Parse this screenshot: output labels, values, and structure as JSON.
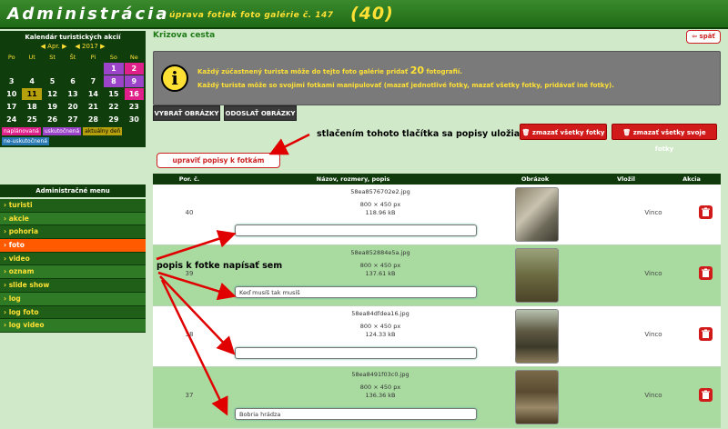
{
  "header": {
    "title": "Administrácia",
    "subtitle": "úprava fotiek foto galérie č. 147",
    "count": "(40)"
  },
  "calendar": {
    "title": "Kalendár turistických akcií",
    "month": "Apr.",
    "year": "2017",
    "prev": "◀",
    "next": "▶",
    "weekdays": [
      "Po",
      "Ut",
      "St",
      "Št",
      "Pi",
      "So",
      "Ne"
    ],
    "legend": [
      "naplánovaná",
      "uskutočnená",
      "aktuálny deň",
      "ne-uskutočnená"
    ]
  },
  "menu": {
    "title": "Administračné menu",
    "items": [
      "turisti",
      "akcie",
      "pohoria",
      "foto",
      "video",
      "oznam",
      "slide show",
      "log",
      "log foto",
      "log video"
    ],
    "active": "foto"
  },
  "main": {
    "title": "Krizova cesta",
    "back": "späť",
    "info1_pre": "Každý zúčastnený turista môže do tejto foto galérie pridať",
    "info1_num": "20",
    "info1_post": "fotografií.",
    "info2": "Každý turista môže so svojimi fotkami manipulovať (mazať jednotlivé fotky, mazať všetky fotky, pridávať iné fotky).",
    "btn_select": "VYBRAŤ OBRÁZKY",
    "btn_send": "ODOSLAŤ OBRÁZKY",
    "btn_delete_all": "zmazať všetky fotky",
    "btn_delete_own": "zmazať všetky svoje fotky",
    "btn_edit": "upraviť popisy k fotkám",
    "annotation_top": "stlačením tohoto tlačítka sa popisy uložia",
    "annotation_left": "popis k fotke napísať sem"
  },
  "table": {
    "headers": [
      "Por. č.",
      "Názov, rozmery, popis",
      "Obrázok",
      "Vložil",
      "Akcia"
    ],
    "rows": [
      {
        "por": "40",
        "file": "58ea8576702e2.jpg",
        "dims": "800 × 450 px",
        "size": "118.96 kB",
        "desc": "",
        "user": "Vinco"
      },
      {
        "por": "39",
        "file": "58ea852884e5a.jpg",
        "dims": "800 × 450 px",
        "size": "137.61 kB",
        "desc": "Keď musíš tak musíš",
        "user": "Vinco"
      },
      {
        "por": "38",
        "file": "58ea84dfdea16.jpg",
        "dims": "800 × 450 px",
        "size": "124.33 kB",
        "desc": "",
        "user": "Vinco"
      },
      {
        "por": "37",
        "file": "58ea8491f03c0.jpg",
        "dims": "800 × 450 px",
        "size": "136.36 kB",
        "desc": "Bobria hrádza",
        "user": "Vinco"
      }
    ]
  },
  "colors": {
    "brand_green": "#1f6a16",
    "accent_yellow": "#ffe135",
    "danger_red": "#d11a1a",
    "active_orange": "#ff5a00"
  }
}
